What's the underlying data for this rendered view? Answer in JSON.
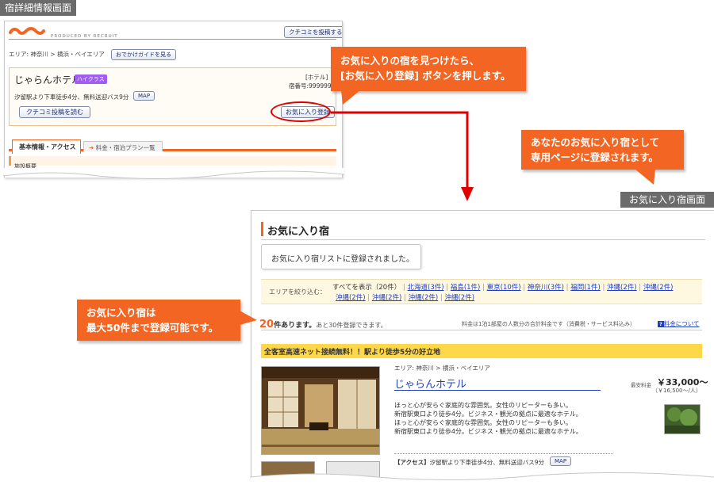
{
  "labels": {
    "detail_screen": "宿詳細情報画面",
    "favorite_screen": "お気に入り宿画面"
  },
  "callouts": {
    "c1_line1": "お気に入りの宿を見つけたら、",
    "c1_line2": "[お気に入り登録] ボタンを押します。",
    "c2_line1": "あなたのお気に入り宿として",
    "c2_line2": "専用ページに登録されます。",
    "c3_line1": "お気に入り宿は",
    "c3_line2": "最大50件まで登録可能です。"
  },
  "detail": {
    "logo_text": "じゃらん",
    "produced_by": "PRODUCED BY RECRUIT",
    "review_post_btn": "クチコミを投稿する",
    "breadcrumb": "エリア: 神奈川 > 横浜・ベイエリア",
    "guide_btn": "おでかけガイドを見る",
    "hotel_name": "じゃらんホテル",
    "class_badge": "ハイクラス",
    "hotel_type": "[ホテル]",
    "hotel_number": "宿番号:999999",
    "access": "汐留駅より下車徒歩4分、無料送迎バス9分",
    "map_btn": "MAP",
    "read_reviews_btn": "クチコミ投稿を読む",
    "favorite_btn": "お気に入り登録",
    "tab_basic": "基本情報・アクセス",
    "tab_plans": "料金・宿泊プラン一覧",
    "facility_overview": "施設概要"
  },
  "favorite": {
    "title": "お気に入り宿",
    "registered_msg": "お気に入り宿リストに登録されました。",
    "filter_label": "エリアを絞り込む：",
    "filter_all": "すべてを表示（20件）",
    "filters_row1": [
      "北海道(3件)",
      "福島(1件)",
      "東京(10件)",
      "神奈川(3件)",
      "福岡(1件)",
      "沖縄(2件)",
      "沖縄(2件)"
    ],
    "filters_row2": [
      "沖縄(2件)",
      "沖縄(2件)",
      "沖縄(2件)",
      "沖縄(2件)"
    ],
    "count_number": "20",
    "count_suffix": "件あります。",
    "remaining": "あと30件登録できます。",
    "price_note": "料金は1泊1部屋の人数分の合計料金です（消費税・サービス料込み）",
    "price_about_icon": "?",
    "price_about": "料金について",
    "banner": "全客室高速ネット接続無料！！駅より徒歩5分の好立地",
    "area": "エリア: 神奈川 > 横浜・ベイエリア",
    "hotel_name": "じゃらんホテル",
    "lowest_label": "最安料金",
    "price": "￥33,000～",
    "price_per": "（￥16,500～/人）",
    "desc_lines": [
      "ほっと心が安らぐ家庭的な雰囲気。女性のリピーターも多い。",
      "新宿駅東口より徒歩4分。ビジネス・観光の拠点に最適なホテル。",
      "ほっと心が安らぐ家庭的な雰囲気。女性のリピーターも多い。",
      "新宿駅東口より徒歩4分。ビジネス・観光の拠点に最適なホテル。"
    ],
    "access_label": "【アクセス】",
    "access": "汐留駅より下車徒歩4分、無料送迎バス9分",
    "map_btn": "MAP"
  },
  "colors": {
    "accent_orange": "#f26522",
    "arrow_red": "#e00000",
    "banner_yellow": "#ffd84a",
    "link_blue": "#1f3fbf"
  }
}
